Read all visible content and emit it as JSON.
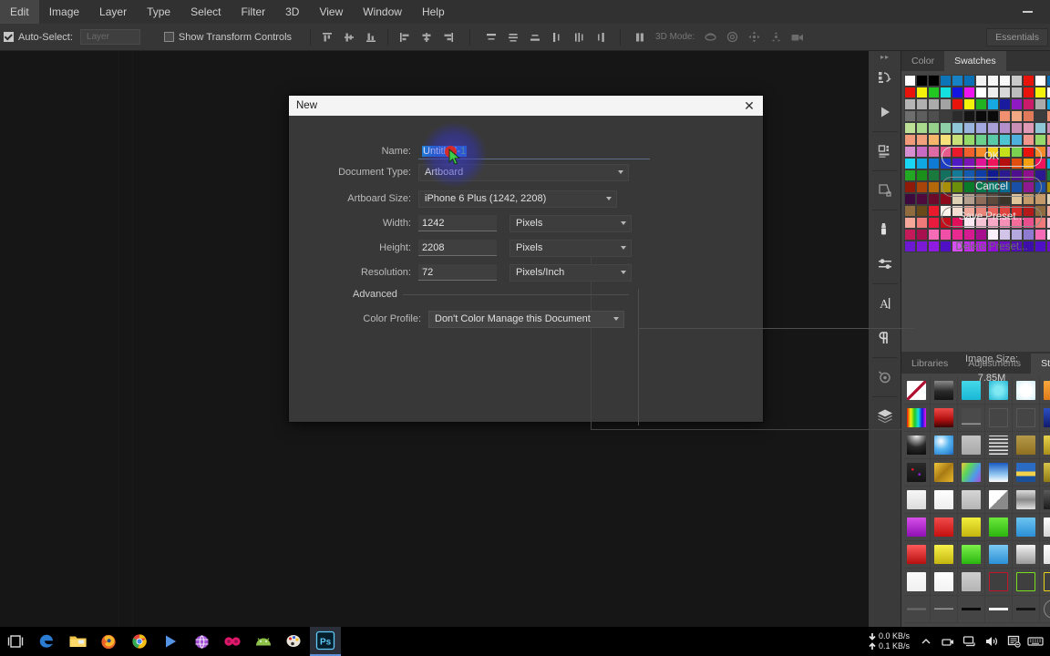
{
  "app": {
    "name": "Adobe Photoshop",
    "workspace_label": "Essentials"
  },
  "menubar": {
    "items": [
      "Edit",
      "Image",
      "Layer",
      "Type",
      "Select",
      "Filter",
      "3D",
      "View",
      "Window",
      "Help"
    ]
  },
  "options_bar": {
    "auto_select_label": "Auto-Select:",
    "auto_select_checked": true,
    "layer_combo_value": "Layer",
    "show_transform_label": "Show Transform Controls",
    "show_transform_checked": false,
    "mode_3d_label": "3D Mode:"
  },
  "dialog": {
    "title": "New",
    "close_icon": "close-icon",
    "fields": {
      "name_label": "Name:",
      "name_value": "Untitled-1",
      "name_value_head": "Untitled-",
      "name_value_tail": "1",
      "doc_type_label": "Document Type:",
      "doc_type_value": "Artboard",
      "artboard_size_label": "Artboard Size:",
      "artboard_size_value": "iPhone 6 Plus (1242, 2208)",
      "width_label": "Width:",
      "width_value": "1242",
      "width_unit": "Pixels",
      "height_label": "Height:",
      "height_value": "2208",
      "height_unit": "Pixels",
      "resolution_label": "Resolution:",
      "resolution_value": "72",
      "resolution_unit": "Pixels/Inch",
      "advanced_label": "Advanced",
      "color_profile_label": "Color Profile:",
      "color_profile_value": "Don't Color Manage this Document"
    },
    "buttons": {
      "ok": "OK",
      "cancel": "Cancel",
      "save_preset": "Save Preset...",
      "delete_preset": "Delete Preset...",
      "delete_preset_disabled": true
    },
    "image_size_label": "Image Size:",
    "image_size_value": "7.85M"
  },
  "panels": {
    "top_tabs": [
      {
        "label": "Color",
        "active": false
      },
      {
        "label": "Swatches",
        "active": true
      }
    ],
    "bottom_tabs": [
      {
        "label": "Libraries",
        "active": false
      },
      {
        "label": "Adjustments",
        "active": false
      },
      {
        "label": "Styles",
        "active": true
      }
    ],
    "collapse_icon": "double-chevron-icon"
  },
  "swatches": {
    "rows": [
      [
        "#ffffff",
        "#000000",
        "#000000",
        "#0d74b8",
        "#1681c4",
        "#0b6fb5",
        "#f2f2f2",
        "#f7f7f7",
        "#f9f9f9",
        "#c9c9c9",
        "#e8140c"
      ],
      [
        "#e8140c",
        "#f2f20a",
        "#22c722",
        "#14e0e0",
        "#1414e0",
        "#ee14ee",
        "#ffffff",
        "#ededed",
        "#d8d8d8",
        "#bdbdbd",
        "#e8140c"
      ],
      [
        "#b5b5b5",
        "#b0b0b0",
        "#ababab",
        "#a3a3a3",
        "#e8140c",
        "#f2f20a",
        "#22b322",
        "#16a8e0",
        "#1a1a9e",
        "#8f1ac4",
        "#cc1a6b"
      ],
      [
        "#6e6e6e",
        "#5e5e5e",
        "#4f4f4f",
        "#3d3d3d",
        "#2b2b2b",
        "#141414",
        "#0a0a0a",
        "#0a0a0a",
        "#f09070",
        "#f2a882",
        "#e07a5a"
      ],
      [
        "#bde096",
        "#a8d98c",
        "#96d18c",
        "#8fcfa8",
        "#8fc7d6",
        "#9ab5de",
        "#a3a8de",
        "#a8a0d6",
        "#b58fc9",
        "#c98fb5",
        "#e09ab5"
      ],
      [
        "#f09a7a",
        "#f0a07a",
        "#f5b56b",
        "#f5e07a",
        "#c9e07a",
        "#96d96b",
        "#6bd18c",
        "#5ac9a8",
        "#4fc4d1",
        "#4fb0de",
        "#f0968c"
      ],
      [
        "#d68fd1",
        "#c96bc4",
        "#de6ba3",
        "#e85a8c",
        "#e81a2b",
        "#f0602b",
        "#f58a2b",
        "#f5d11a",
        "#c4e01a",
        "#7ad14f",
        "#e8140c"
      ],
      [
        "#1ad6f5",
        "#0fa8e0",
        "#0f7ad1",
        "#1a3dc4",
        "#4f1ac4",
        "#7a14b5",
        "#e01496",
        "#f0145a",
        "#b50f0f",
        "#e04f0f",
        "#f5a00f"
      ],
      [
        "#22a822",
        "#1a8f1a",
        "#1a7a3d",
        "#14705e",
        "#147a96",
        "#145ab0",
        "#0f3da8",
        "#0f1a8f",
        "#2b1a8f",
        "#4f0f8f",
        "#8f0f8f"
      ],
      [
        "#8f1a0a",
        "#a8430a",
        "#b5690a",
        "#a88f0a",
        "#6b8f0a",
        "#0a7a2b",
        "#0a7a4f",
        "#0a7a6b",
        "#0a6b8f",
        "#1a4fa8",
        "#8f1a8f"
      ],
      [
        "#3d0a3d",
        "#4f0a3d",
        "#6b0a2b",
        "#8f0a1a",
        "#ded1b5",
        "#b5a08f",
        "#8f6b5a",
        "#5e4a3d",
        "#3d3429",
        "#e0c49a",
        "#c49a6b"
      ],
      [
        "#8f6b3d",
        "#6b4a1a",
        "#e81a2b",
        "#fff5ed",
        "#f5ded1",
        "#f0a89a",
        "#e8857a",
        "#e8605a",
        "#e0423d",
        "#d62b29",
        "#b51a1a"
      ],
      [
        "#f5a89a",
        "#f07a7a",
        "#e81a3d",
        "#c40f1a",
        "#e00f5a",
        "#fce8f0",
        "#f7c4d6",
        "#f7a8c4",
        "#f58fb5",
        "#f56b9a",
        "#e84f8c"
      ],
      [
        "#c41a5a",
        "#a80f4f",
        "#f56bb5",
        "#f04fa8",
        "#e8298f",
        "#d61a8f",
        "#a80f8f",
        "#fcf0fc",
        "#d1c4e8",
        "#b5a8de",
        "#8f7ad1"
      ],
      [
        "#6b1ad1",
        "#7a1ad6",
        "#8f1ae0",
        "#4f0fc4",
        "#d64ff5",
        "#c42bf0",
        "#b51ae8",
        "#8f0fd6",
        "#6b0fc4",
        "#4f0fb5",
        "#3d0fa8"
      ]
    ]
  },
  "styles": {
    "grid": [
      [
        "none",
        "black-gloss",
        "cyan-fill",
        "cyan-inner",
        "white-glow",
        "orange-edge"
      ],
      [
        "spectrum",
        "red-gradient",
        "thin-line",
        "empty-square",
        "empty-square",
        "blue-dark"
      ],
      [
        "black-vignette",
        "blue-sky",
        "grey-flat",
        "sketch-lines",
        "gold-soft",
        "yellow-thin"
      ],
      [
        "dark-confetti",
        "gold-texture",
        "rainbow-blur",
        "blue-fade",
        "blue-yellow-stripe",
        "text-style"
      ],
      [
        "white-soft",
        "white-plain",
        "grey-soft",
        "white-fold",
        "silver-band",
        "dark-band"
      ],
      [
        "purple-gloss",
        "red-gloss",
        "yellow-gloss",
        "green-gloss",
        "blue-gloss",
        "white-gloss"
      ],
      [
        "red-shine",
        "yellow-shine",
        "green-shine",
        "blue-shine",
        "silver-shine",
        "white-shine"
      ],
      [
        "white-matte",
        "white-card",
        "grey-card",
        "red-outline",
        "green-outline",
        "yellow-outline"
      ],
      [
        "line-thin",
        "line-fade",
        "line-black",
        "line-white",
        "line-dark",
        "cancel"
      ]
    ]
  },
  "taskbar": {
    "items": [
      {
        "name": "task-view-icon",
        "label": "Task View"
      },
      {
        "name": "edge-icon",
        "label": "Microsoft Edge"
      },
      {
        "name": "file-explorer-icon",
        "label": "File Explorer"
      },
      {
        "name": "firefox-icon",
        "label": "Firefox"
      },
      {
        "name": "chrome-icon",
        "label": "Google Chrome"
      },
      {
        "name": "media-player-icon",
        "label": "Media Player"
      },
      {
        "name": "globe-icon",
        "label": "Browser"
      },
      {
        "name": "odoo-icon",
        "label": "Odoo"
      },
      {
        "name": "android-icon",
        "label": "Android Studio"
      },
      {
        "name": "paint-icon",
        "label": "Paint"
      },
      {
        "name": "photoshop-icon",
        "label": "Ps",
        "active": true
      }
    ],
    "tray": {
      "download_speed": "0.0 KB/s",
      "upload_speed": "0.1 KB/s",
      "icons": [
        "chevron-up-icon",
        "usb-icon",
        "network-icon",
        "volume-icon",
        "action-center-icon",
        "keyboard-icon"
      ]
    }
  }
}
